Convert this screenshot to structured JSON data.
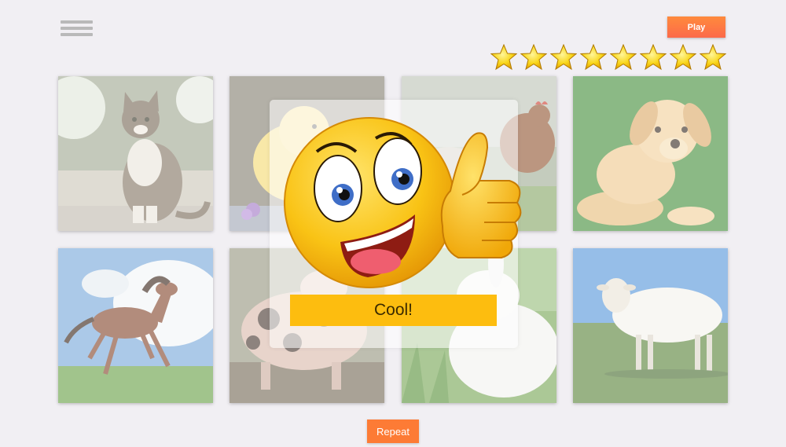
{
  "header": {
    "menu_icon": "hamburger-icon",
    "play_label": "Play",
    "play_color": "#fc6a4a",
    "stars_count": 8,
    "star_icon": "star-icon"
  },
  "grid": {
    "cards": [
      {
        "animal": "cat"
      },
      {
        "animal": "chick"
      },
      {
        "animal": "hen"
      },
      {
        "animal": "dog"
      },
      {
        "animal": "horse"
      },
      {
        "animal": "pig"
      },
      {
        "animal": "rabbit"
      },
      {
        "animal": "sheep"
      }
    ]
  },
  "modal": {
    "emoji_icon": "thumbs-up-emoji-icon",
    "button_label": "Cool!",
    "button_color": "#fdbd0f"
  },
  "footer": {
    "repeat_label": "Repeat",
    "repeat_color": "#fd7b35"
  }
}
